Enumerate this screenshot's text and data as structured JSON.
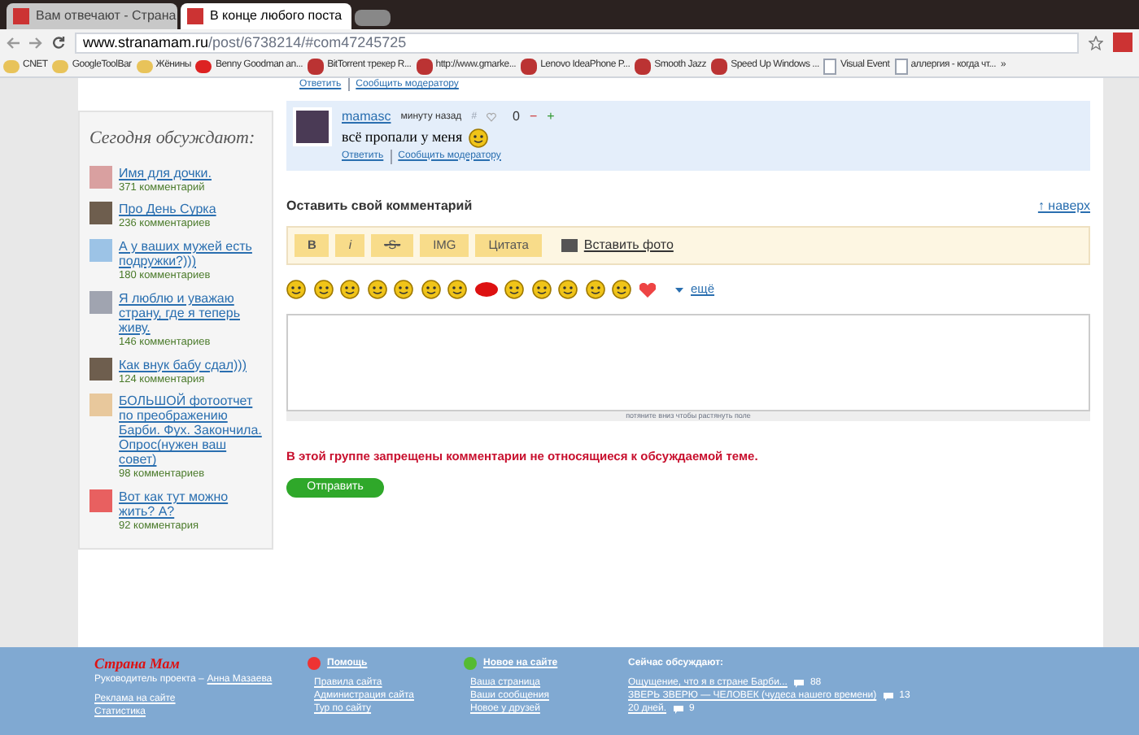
{
  "browser": {
    "tabs": [
      {
        "title": "Вам отвечают - Страна",
        "selected": false
      },
      {
        "title": "В конце любого поста",
        "selected": true
      }
    ],
    "url_host": "www.stranamam.ru",
    "url_path": "/post/6738214/#com47245725",
    "bookmarks": [
      {
        "label": "CNET",
        "kind": "folder"
      },
      {
        "label": "GoogleToolBar",
        "kind": "folder"
      },
      {
        "label": "Жёнины",
        "kind": "folder"
      },
      {
        "label": "Benny Goodman an...",
        "kind": "video"
      },
      {
        "label": "BitTorrent трекер R...",
        "kind": "site"
      },
      {
        "label": "http://www.gmarke...",
        "kind": "site"
      },
      {
        "label": "Lenovo IdeaPhone P...",
        "kind": "site"
      },
      {
        "label": "Smooth Jazz",
        "kind": "site"
      },
      {
        "label": "Speed Up Windows ...",
        "kind": "site"
      },
      {
        "label": "Visual Event",
        "kind": "page"
      },
      {
        "label": "аллергия - когда чт...",
        "kind": "page"
      }
    ],
    "more": "»"
  },
  "sidebar": {
    "title": "Сегодня обсуждают:",
    "items": [
      {
        "title": "Имя для дочки.",
        "comments": "371 комментарий",
        "color": "#d9a0a0"
      },
      {
        "title": "Про День Сурка",
        "comments": "236 комментариев",
        "color": "#6e5e4e"
      },
      {
        "title": "А у ваших мужей есть подружки?)))",
        "comments": "180 комментариев",
        "color": "#9cc3e6"
      },
      {
        "title": "Я люблю и уважаю страну, где я теперь живу.",
        "comments": "146 комментариев",
        "color": "#a0a4b0"
      },
      {
        "title": "Как внук бабу сдал)))",
        "comments": "124 комментария",
        "color": "#6e5e4e"
      },
      {
        "title": "БОЛЬШОЙ фотоотчет по преображению Барби. Фух. Закончила. Опрос(нужен ваш совет)",
        "comments": "98 комментариев",
        "color": "#e8c89c"
      },
      {
        "title": "Вот как тут можно жить? А?",
        "comments": "92 комментария",
        "color": "#e86060"
      }
    ]
  },
  "prev_comment_links": [
    "Ответить",
    "Сообщить модератору"
  ],
  "comment": {
    "author": "mamasc",
    "time": "минуту назад",
    "hash": "#",
    "score": "0",
    "minus": "−",
    "plus": "+",
    "text": "всё пропали у меня",
    "links": [
      "Ответить",
      "Сообщить модератору"
    ]
  },
  "form": {
    "title": "Оставить свой комментарий",
    "top_link": "↑ наверх",
    "toolbar": [
      {
        "label": "B",
        "kind": "bold"
      },
      {
        "label": "i",
        "kind": "italic"
      },
      {
        "label": "-S-",
        "kind": "strike"
      },
      {
        "label": "IMG",
        "kind": "plain"
      },
      {
        "label": "Цитата",
        "kind": "plain"
      }
    ],
    "photo_link": "Вставить фото",
    "more_smileys": "ещё",
    "resize_hint": "потяните вниз чтобы растянуть поле",
    "warning": "В этой группе запрещены комментарии не относящиеся к обсуждаемой теме.",
    "submit": "Отправить"
  },
  "footer": {
    "logo": "Страна Мам",
    "manager_label": "Руководитель проекта –",
    "manager": "Анна Мазаева",
    "links_left": [
      "Реклама на сайте",
      "Статистика"
    ],
    "help": {
      "title": "Помощь",
      "links": [
        "Правила сайта",
        "Администрация сайта",
        "Тур по сайту"
      ]
    },
    "news": {
      "title": "Новое на сайте",
      "links": [
        "Ваша страница",
        "Ваши сообщения",
        "Новое у друзей"
      ]
    },
    "discussing": {
      "title": "Сейчас обсуждают:",
      "items": [
        {
          "title": "Ощущение, что я в стране Барби...",
          "count": "88"
        },
        {
          "title": "ЗВЕРЬ ЗВЕРЮ — ЧЕЛОВЕК (чудеса нашего времени)",
          "count": "13"
        },
        {
          "title": "20 дней.",
          "count": "9"
        }
      ]
    }
  }
}
